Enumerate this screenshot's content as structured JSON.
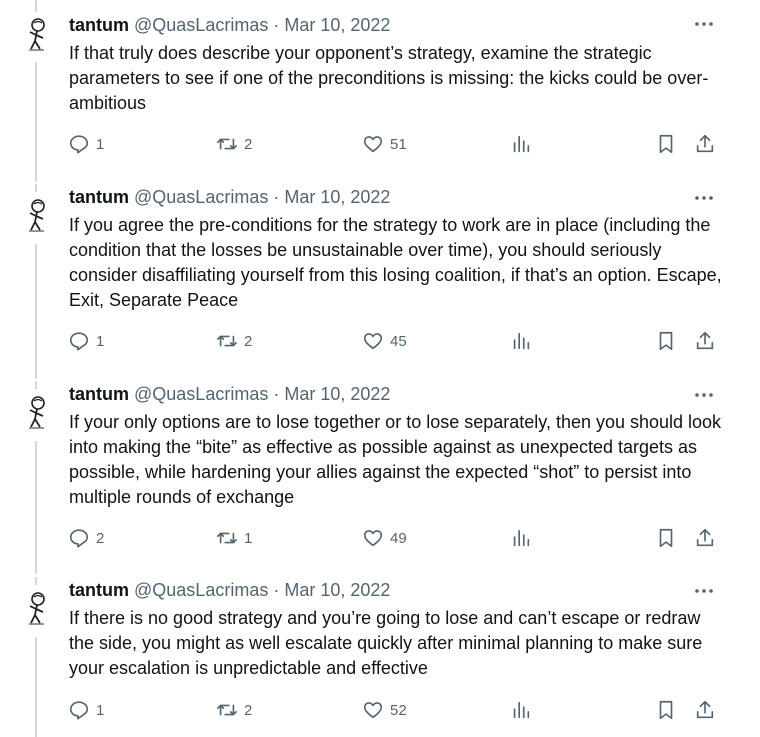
{
  "author": {
    "name": "tantum",
    "handle": "@QuasLacrimas",
    "avatar_icon": "sketch-figure-avatar"
  },
  "separator": "·",
  "more_icon": "ellipsis-icon",
  "tweets": [
    {
      "date": "Mar 10, 2022",
      "text": "If that truly does describe your opponent’s strategy, examine the strategic parameters to see if one of the preconditions is missing: the kicks could be over-ambitious",
      "replies": "1",
      "retweets": "2",
      "likes": "51"
    },
    {
      "date": "Mar 10, 2022",
      "text": "If you agree the pre-conditions for the strategy to work are in place (including the condition that the losses be unsustainable over time), you should seriously consider disaffiliating yourself from this losing coalition, if that’s an option. Escape, Exit, Separate Peace",
      "replies": "1",
      "retweets": "2",
      "likes": "45"
    },
    {
      "date": "Mar 10, 2022",
      "text": "If your only options are to lose together or to lose separately, then you should look into making the “bite” as effective as possible against as unexpected targets as possible, while hardening your allies against the expected “shot” to persist into multiple rounds of exchange",
      "replies": "2",
      "retweets": "1",
      "likes": "49"
    },
    {
      "date": "Mar 10, 2022",
      "text": "If there is no good strategy and you’re going to lose and can’t escape or redraw the side, you might as well escalate quickly after minimal planning to make sure your escalation is unpredictable and effective",
      "replies": "1",
      "retweets": "2",
      "likes": "52"
    }
  ],
  "colors": {
    "text": "#0f1419",
    "secondary": "#536471",
    "thread_line": "#cfd9de"
  }
}
